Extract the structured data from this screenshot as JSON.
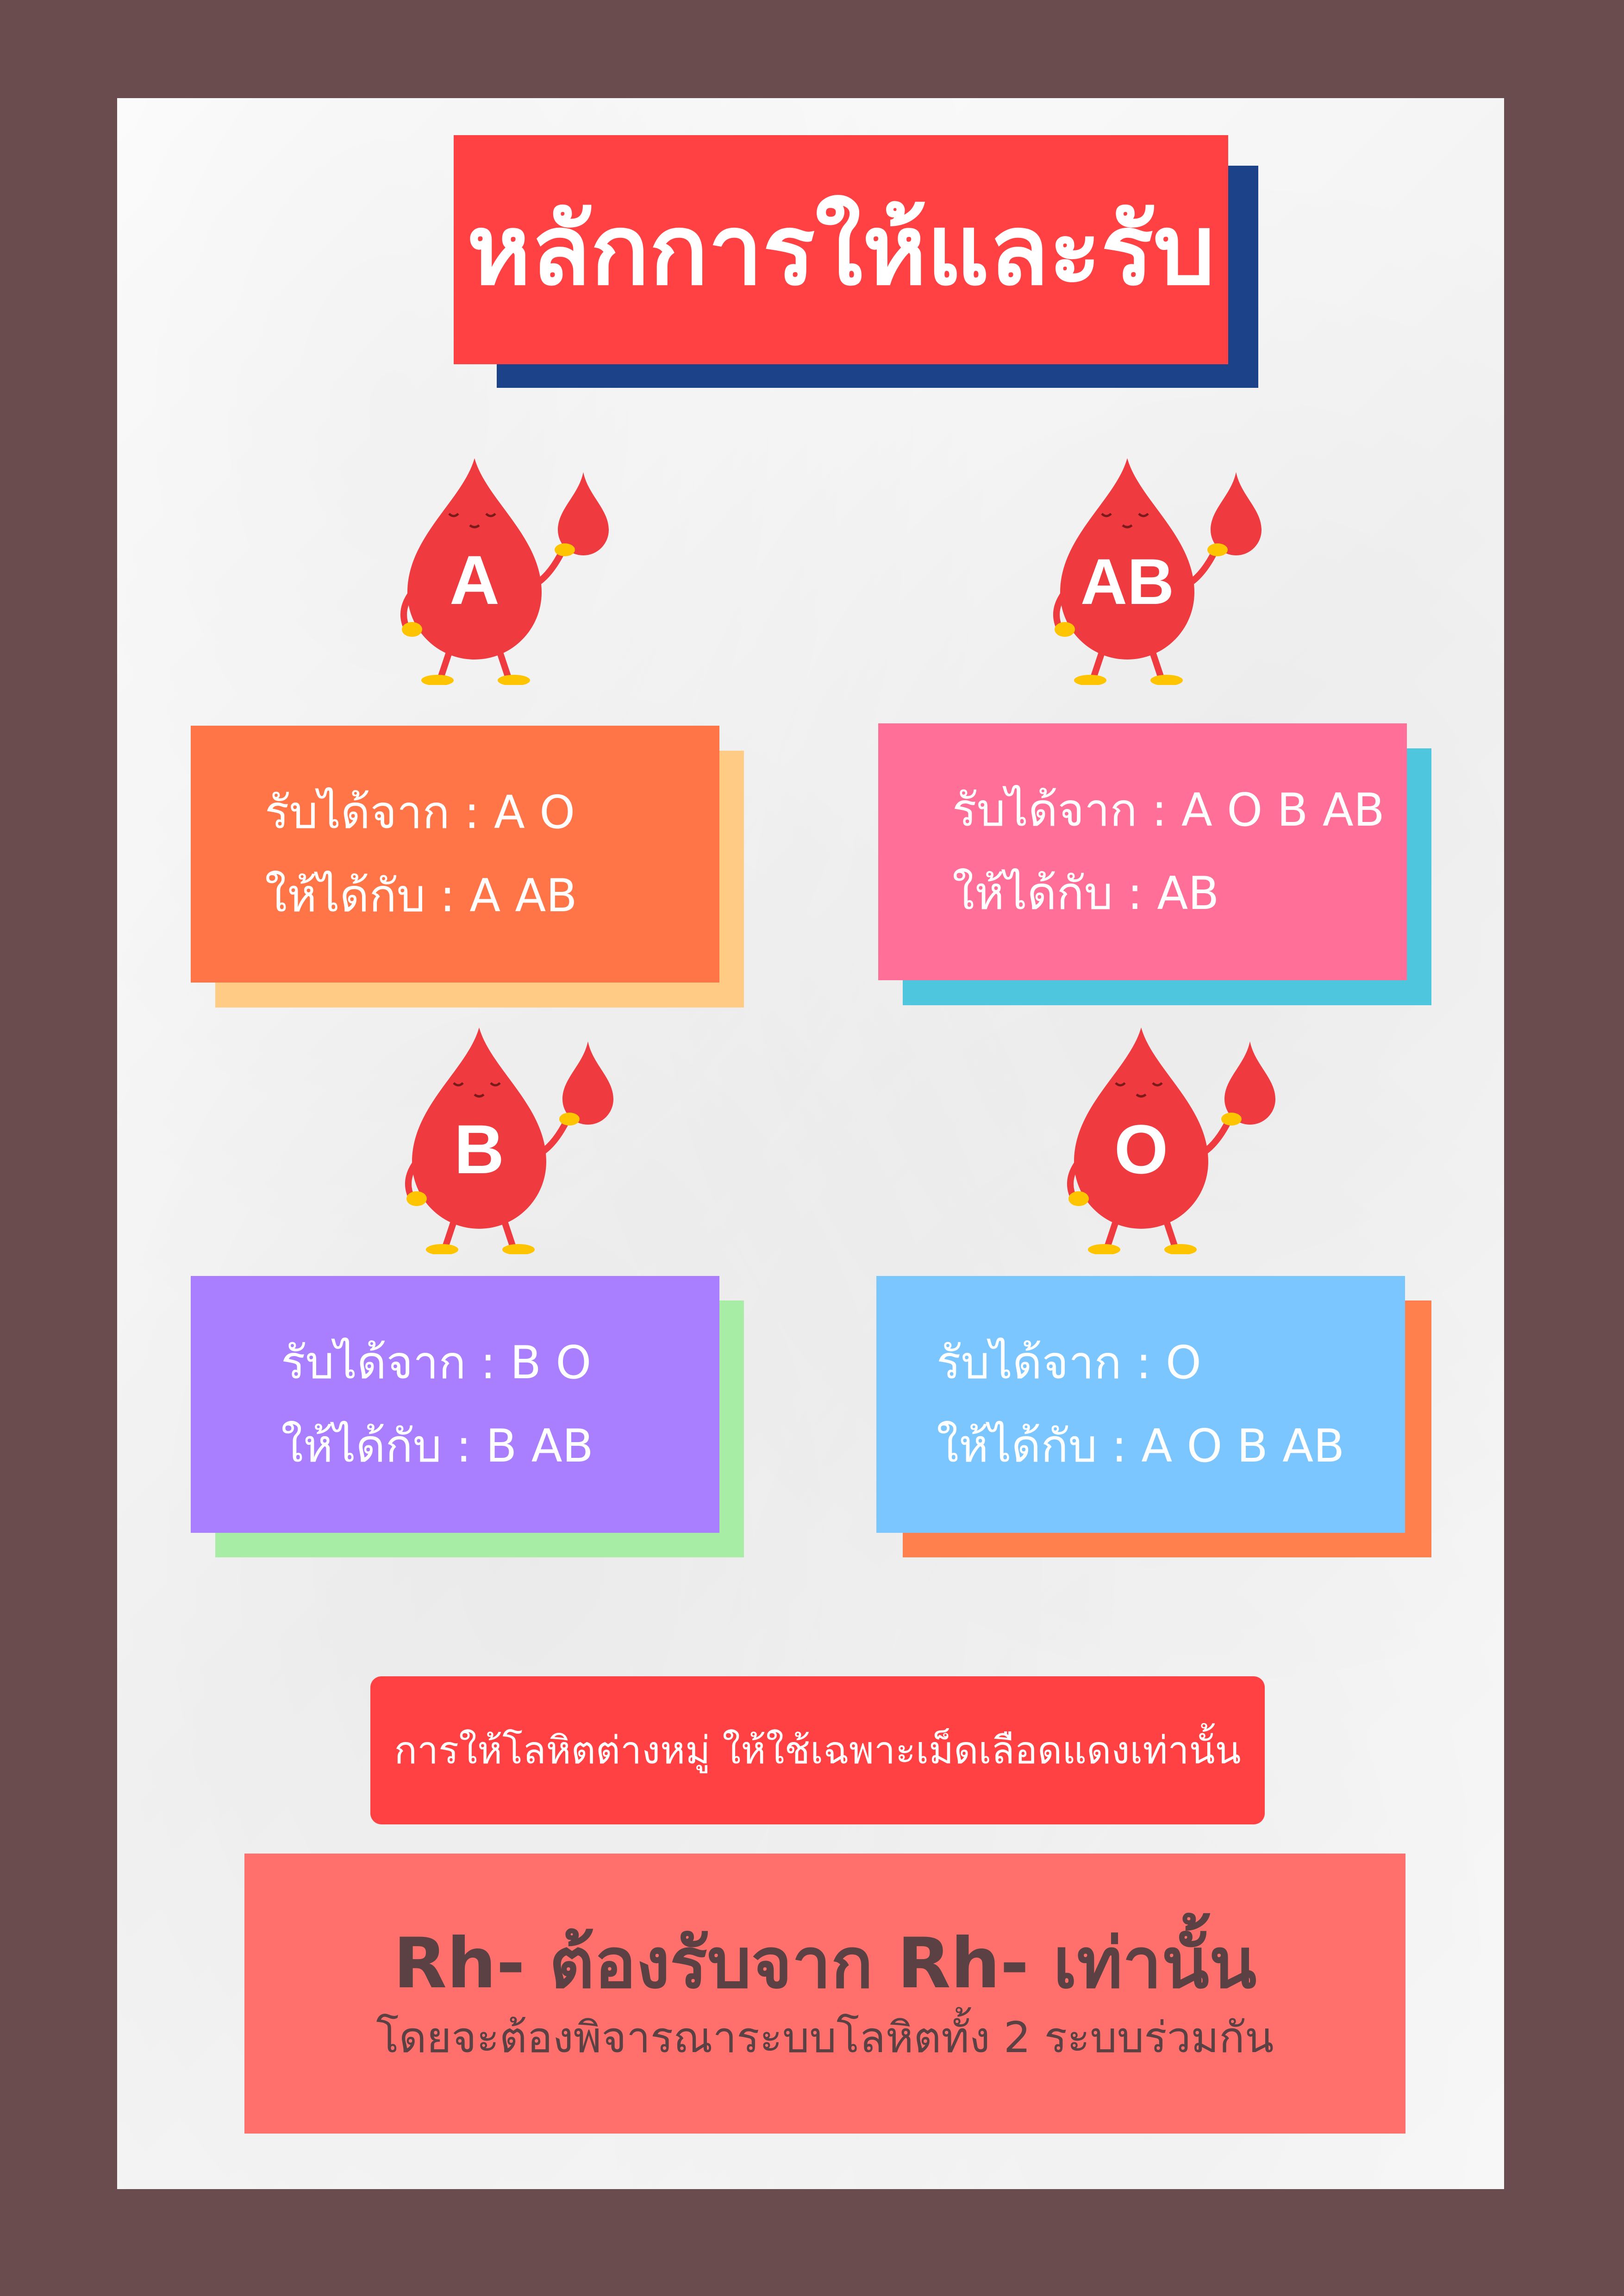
{
  "title": "หลักการให้และรับ",
  "groups": [
    {
      "label": "A",
      "receive": "รับได้จาก : A  O",
      "give": "ให้ได้กับ : A  AB"
    },
    {
      "label": "AB",
      "receive": "รับได้จาก : A O B AB",
      "give": "ให้ได้กับ : AB"
    },
    {
      "label": "B",
      "receive": "รับได้จาก : B O",
      "give": "ให้ได้กับ : B AB"
    },
    {
      "label": "O",
      "receive": "รับได้จาก : O",
      "give": "ให้ได้กับ : A O B AB"
    }
  ],
  "note": "การให้โลหิตต่างหมู่ ให้ใช้เฉพาะเม็ดเลือดแดงเท่านั้น",
  "rh": {
    "main": "Rh- ต้องรับจาก Rh- เท่านั้น",
    "sub": "โดยจะต้องพิจารณาระบบโลหิตทั้ง 2 ระบบร่วมกัน"
  },
  "colors": {
    "background": "#6b4c4e",
    "title_box": "#ff4144",
    "title_shadow": "#1c4289",
    "card_a": "#ff7547",
    "card_a_shadow": "#ffcb85",
    "card_ab": "#ff6f98",
    "card_ab_shadow": "#4ec6de",
    "card_b": "#a97eff",
    "card_b_shadow": "#a8eda6",
    "card_o": "#7cc6ff",
    "card_o_shadow": "#ff7f4d",
    "drop": "#ef3b3f",
    "note": "#ff4144",
    "rh_box": "#ff6f6b"
  },
  "icons": [
    "blood-drop-mascot-a",
    "blood-drop-mascot-ab",
    "blood-drop-mascot-b",
    "blood-drop-mascot-o"
  ]
}
